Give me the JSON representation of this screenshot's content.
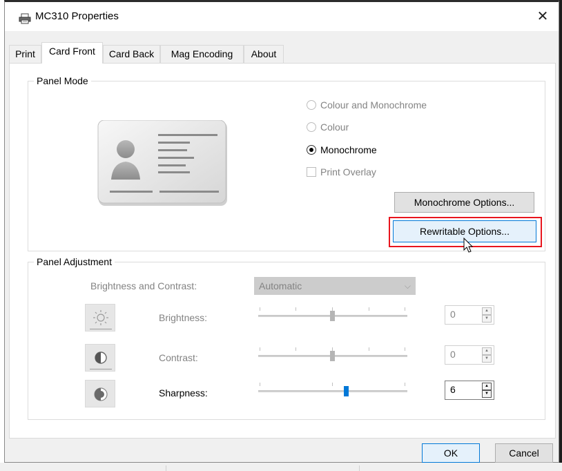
{
  "window": {
    "title": "MC310 Properties",
    "close_label": "✕"
  },
  "tabs": [
    {
      "label": "Print",
      "active": false
    },
    {
      "label": "Card Front",
      "active": true
    },
    {
      "label": "Card Back",
      "active": false
    },
    {
      "label": "Mag Encoding",
      "active": false
    },
    {
      "label": "About",
      "active": false
    }
  ],
  "panel_mode": {
    "legend": "Panel Mode",
    "options": [
      {
        "label": "Colour and Monochrome",
        "selected": false,
        "enabled": false
      },
      {
        "label": "Colour",
        "selected": false,
        "enabled": false
      },
      {
        "label": "Monochrome",
        "selected": true,
        "enabled": true
      }
    ],
    "print_overlay": {
      "label": "Print Overlay",
      "checked": false,
      "enabled": false
    },
    "monochrome_options_label": "Monochrome Options...",
    "rewritable_options_label": "Rewritable Options..."
  },
  "panel_adjustment": {
    "legend": "Panel Adjustment",
    "brightness_contrast_label": "Brightness and Contrast:",
    "brightness_contrast_value": "Automatic",
    "rows": [
      {
        "label": "Brightness:",
        "value": "0",
        "enabled": false,
        "icon": "sun-icon"
      },
      {
        "label": "Contrast:",
        "value": "0",
        "enabled": false,
        "icon": "contrast-icon"
      },
      {
        "label": "Sharpness:",
        "value": "6",
        "enabled": true,
        "icon": "sharpness-icon"
      }
    ]
  },
  "footer": {
    "ok_label": "OK",
    "cancel_label": "Cancel"
  },
  "colors": {
    "accent": "#0078d7",
    "highlight": "#e8151d",
    "disabled_text": "#838383"
  }
}
